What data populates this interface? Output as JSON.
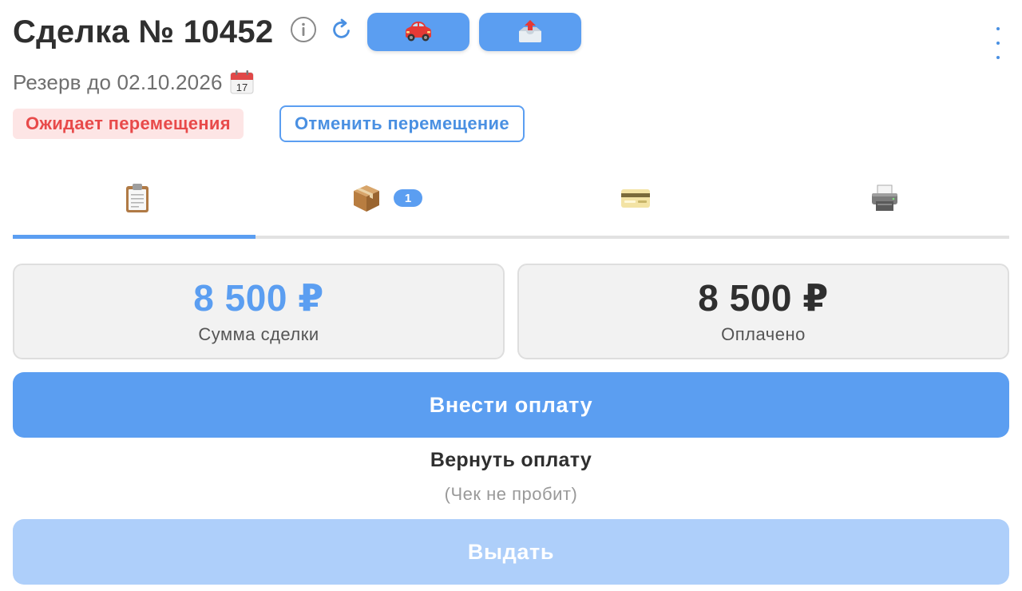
{
  "header": {
    "title": "Сделка № 10452",
    "info_icon": "info-circle-icon",
    "refresh_icon": "refresh-icon",
    "car_button_icon": "red-car-icon",
    "outbox_button_icon": "outbox-tray-icon",
    "more_icon": "vertical-dots-icon"
  },
  "reserve": {
    "text": "Резерв до 02.10.2026",
    "calendar_icon": "calendar-icon"
  },
  "status": {
    "badge": "Ожидает перемещения",
    "cancel_label": "Отменить перемещение"
  },
  "tabs": [
    {
      "icon": "clipboard-icon",
      "active": true
    },
    {
      "icon": "package-icon",
      "badge": "1"
    },
    {
      "icon": "credit-card-icon"
    },
    {
      "icon": "printer-icon"
    }
  ],
  "summary": {
    "deal_amount": "8 500 ₽",
    "deal_label": "Сумма сделки",
    "paid_amount": "8 500 ₽",
    "paid_label": "Оплачено"
  },
  "actions": {
    "pay_label": "Внести оплату",
    "refund_label": "Вернуть оплату",
    "refund_note": "(Чек не пробит)",
    "issue_label": "Выдать",
    "issue_disabled": true
  },
  "colors": {
    "accent": "#5b9ef1",
    "accent_disabled": "#aecffa",
    "danger_text": "#e84a4a",
    "danger_bg": "#fde5e5",
    "card_bg": "#f2f2f2"
  }
}
